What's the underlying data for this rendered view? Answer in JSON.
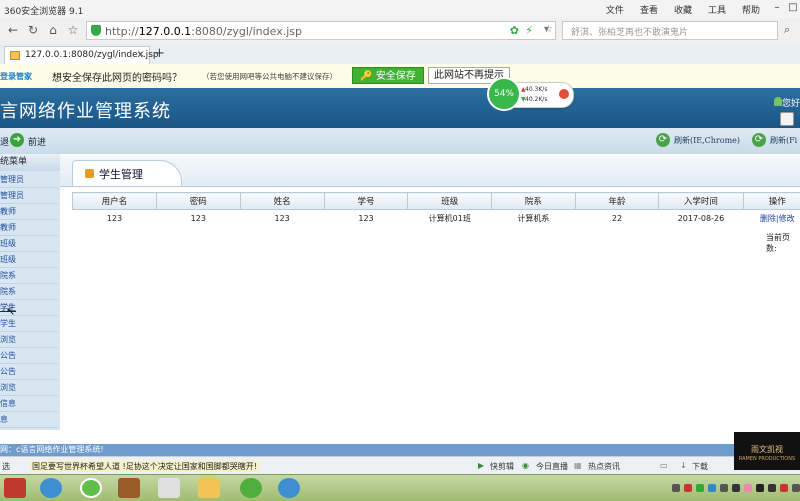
{
  "browser": {
    "title": "360安全浏览器 9.1",
    "menu": [
      "文件",
      "查看",
      "收藏",
      "工具",
      "帮助"
    ],
    "url_host": "127.0.0.1",
    "url_rest": ":8080/zygl/index.jsp",
    "search_hint": "舒淇、张柏芝再也不敢演鬼片",
    "tab_label": "127.0.0.1:8080/zygl/index.jsp",
    "new_tab": "+"
  },
  "password_bar": {
    "brand": "登录管家",
    "question": "想安全保存此网页的密码吗？",
    "note": "（若您使用网吧等公共电脑不建议保存）",
    "save_label": "安全保存",
    "no_prompt_label": "此网站不再提示"
  },
  "speed_widget": {
    "percent": "54%",
    "up": "40.3K/s",
    "down": "40.2K/s"
  },
  "app": {
    "title": "言网络作业管理系统",
    "user": "您好",
    "back": "退",
    "forward": "前进",
    "refresh1": "刷新(IE,Chrome)",
    "refresh2": "刷新(Fi"
  },
  "sidebar": {
    "header": "统菜单",
    "items": [
      "管理员",
      "管理员",
      "教师",
      "教师",
      "班级",
      "班级",
      "院系",
      "院系",
      "学生",
      "学生",
      "浏览",
      "公告",
      "公告",
      "浏览",
      "信息",
      "息"
    ]
  },
  "panel": {
    "tab_label": "学生管理",
    "columns": [
      "用户名",
      "密码",
      "姓名",
      "学号",
      "班级",
      "院系",
      "年龄",
      "入学时间",
      "操作"
    ],
    "rows": [
      [
        "123",
        "123",
        "123",
        "123",
        "计算机01班",
        "计算机系",
        "22",
        "2017-08-26",
        "删除|修改"
      ]
    ],
    "page_info": "当前页数:"
  },
  "status_message": "网：c语言网络作业管理系统!",
  "status_bar": {
    "left": "选",
    "news": "国足要写世界杯希望人道 !足协这个决定让国家和国脚都哭瞎开!",
    "items": [
      "快剪辑",
      "今日直播",
      "热点资讯",
      "下载"
    ]
  },
  "logo": {
    "line1": "雨文凯视",
    "line2": "RAMEN PRODUCTIONS"
  },
  "colors": {
    "header": "#1a5686",
    "save_green": "#3fb234",
    "taskbar": "#9fbd6f"
  }
}
